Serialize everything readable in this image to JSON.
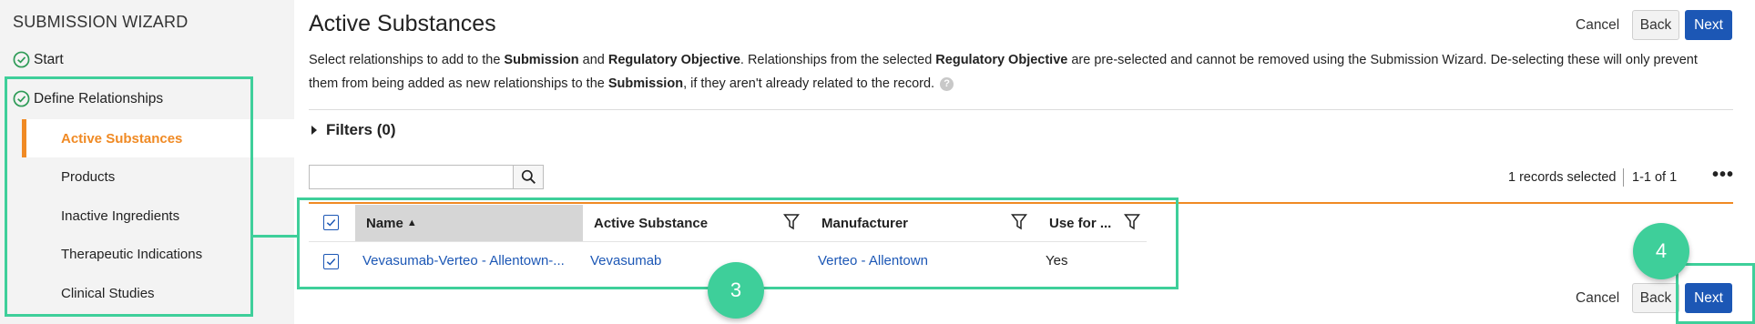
{
  "sidebar": {
    "title": "SUBMISSION WIZARD",
    "steps": [
      {
        "label": "Start"
      },
      {
        "label": "Define Relationships"
      }
    ],
    "substeps": [
      {
        "label": "Active Substances"
      },
      {
        "label": "Products"
      },
      {
        "label": "Inactive Ingredients"
      },
      {
        "label": "Therapeutic Indications"
      },
      {
        "label": "Clinical Studies"
      }
    ]
  },
  "main": {
    "title": "Active Substances",
    "description": {
      "p1": "Select relationships to add to the ",
      "b1": "Submission",
      "p2": " and ",
      "b2": "Regulatory Objective",
      "p3": ". Relationships from the selected ",
      "b3": "Regulatory Objective",
      "p4": " are pre-selected and cannot be removed using the Submission Wizard. De-selecting these will only prevent them from being added as new relationships to the ",
      "b4": "Submission",
      "p5": ", if they aren't already related to the record.",
      "help": "?"
    },
    "filters_label": "Filters (0)",
    "search": {
      "value": "",
      "placeholder": ""
    },
    "records_selected": "1 records selected",
    "page_range": "1-1 of 1",
    "more": "•••"
  },
  "toolbar": {
    "cancel": "Cancel",
    "back": "Back",
    "next": "Next"
  },
  "table": {
    "columns": [
      "Name",
      "Active Substance",
      "Manufacturer",
      "Use for ..."
    ],
    "sort_indicator": "▲",
    "rows": [
      {
        "name": "Vevasumab-Verteo - Allentown-...",
        "active_substance": "Vevasumab",
        "manufacturer": "Verteo - Allentown",
        "use_for": "Yes"
      }
    ]
  },
  "annotations": {
    "badge_3": "3",
    "badge_4": "4"
  },
  "colors": {
    "accent": "#f08a24",
    "primary": "#1c57b5",
    "annotation": "#3ecf9a",
    "check": "#2e9b57"
  }
}
